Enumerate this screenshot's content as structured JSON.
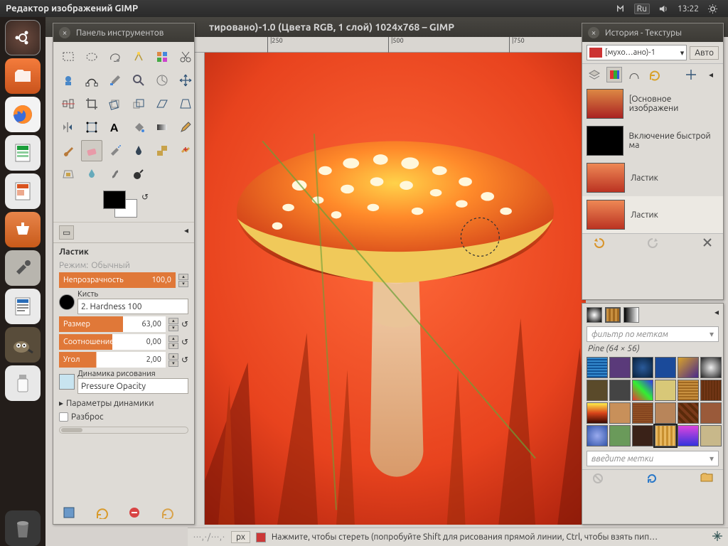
{
  "topbar": {
    "app_title": "Редактор изображений GIMP",
    "lang": "Ru",
    "time": "13:22"
  },
  "canvas": {
    "title_fragment": "тировано)-1.0 (Цвета RGB, 1 слой) 1024x768 – GIMP",
    "ruler_ticks": [
      "|250",
      "|500",
      "|750"
    ]
  },
  "status": {
    "hint": "Нажмите, чтобы стереть (попробуйте Shift для рисования прямой линии, Ctrl, чтобы взять пип…"
  },
  "toolbox": {
    "title": "Панель инструментов",
    "tool_name": "Ластик",
    "mode_label": "Режим:",
    "mode_value": "Обычный",
    "opacity_label": "Непрозрачность",
    "opacity_value": "100,0",
    "brush_label": "Кисть",
    "brush_value": "2. Hardness 100",
    "size_label": "Размер",
    "size_value": "63,00",
    "ratio_label": "Соотношение с…",
    "ratio_value": "0,00",
    "angle_label": "Угол",
    "angle_value": "2,00",
    "dynamics_label": "Динамика рисования",
    "dynamics_value": "Pressure Opacity",
    "dyn_params": "Параметры динамики",
    "scatter": "Разброс"
  },
  "history": {
    "title": "История - Текстуры",
    "image_sel": "[мухо…ано)-1",
    "auto": "Авто",
    "items": [
      {
        "label": "[Основное изображени"
      },
      {
        "label": "Включение быстрой ма"
      },
      {
        "label": "Ластик"
      },
      {
        "label": "Ластик"
      }
    ]
  },
  "patterns": {
    "filter_placeholder": "фильтр по меткам",
    "current": "Pine (64 × 56)",
    "tags_placeholder": "введите метки"
  }
}
